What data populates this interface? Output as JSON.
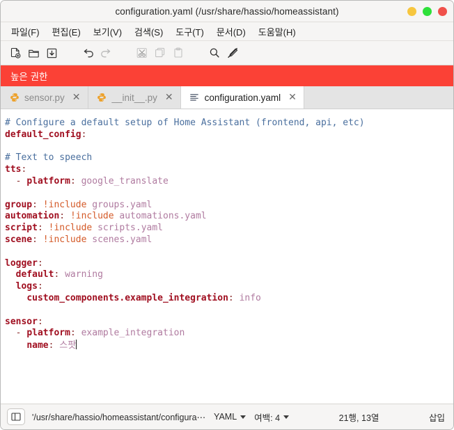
{
  "window": {
    "title": "configuration.yaml (/usr/share/hassio/homeassistant)",
    "controls": [
      {
        "name": "minimize",
        "color": "#f7c63e"
      },
      {
        "name": "maximize",
        "color": "#2ee03a"
      },
      {
        "name": "close",
        "color": "#f0504a"
      }
    ]
  },
  "menubar": {
    "items": [
      {
        "label": "파일(F)"
      },
      {
        "label": "편집(E)"
      },
      {
        "label": "보기(V)"
      },
      {
        "label": "검색(S)"
      },
      {
        "label": "도구(T)"
      },
      {
        "label": "문서(D)"
      },
      {
        "label": "도움말(H)"
      }
    ]
  },
  "toolbar": {
    "items": [
      {
        "icon": "new-file-icon",
        "enabled": true
      },
      {
        "icon": "open-folder-icon",
        "enabled": true
      },
      {
        "icon": "save-file-icon",
        "enabled": true
      },
      {
        "icon": "undo-icon",
        "enabled": true
      },
      {
        "icon": "redo-icon",
        "enabled": false
      },
      {
        "icon": "cut-icon",
        "enabled": false
      },
      {
        "icon": "copy-icon",
        "enabled": false
      },
      {
        "icon": "paste-icon",
        "enabled": false
      },
      {
        "icon": "search-icon",
        "enabled": true
      },
      {
        "icon": "highlight-off-icon",
        "enabled": true
      }
    ]
  },
  "banner": {
    "text": "높은 권한",
    "color": "#fb4136"
  },
  "tabs": [
    {
      "label": "sensor.py",
      "icon": "python-file-icon",
      "active": false,
      "close": "✕"
    },
    {
      "label": "__init__.py",
      "icon": "python-file-icon",
      "active": false,
      "close": "✕"
    },
    {
      "label": "configuration.yaml",
      "icon": "text-file-icon",
      "active": true,
      "close": "✕"
    }
  ],
  "editor": {
    "language": "YAML",
    "lines": [
      [
        {
          "t": "# Configure a default setup of Home Assistant (frontend, api, etc)",
          "c": "cm"
        }
      ],
      [
        {
          "t": "default_config",
          "c": "key"
        },
        {
          "t": ":",
          "c": "pun"
        }
      ],
      [
        {
          "t": "",
          "c": "cm"
        }
      ],
      [
        {
          "t": "# Text to speech",
          "c": "cm"
        }
      ],
      [
        {
          "t": "tts",
          "c": "key"
        },
        {
          "t": ":",
          "c": "pun"
        }
      ],
      [
        {
          "t": "  - ",
          "c": "pun"
        },
        {
          "t": "platform",
          "c": "key"
        },
        {
          "t": ": ",
          "c": "pun"
        },
        {
          "t": "google_translate",
          "c": "val"
        }
      ],
      [
        {
          "t": "",
          "c": "cm"
        }
      ],
      [
        {
          "t": "group",
          "c": "key"
        },
        {
          "t": ": ",
          "c": "pun"
        },
        {
          "t": "!include ",
          "c": "tag"
        },
        {
          "t": "groups.yaml",
          "c": "val"
        }
      ],
      [
        {
          "t": "automation",
          "c": "key"
        },
        {
          "t": ": ",
          "c": "pun"
        },
        {
          "t": "!include ",
          "c": "tag"
        },
        {
          "t": "automations.yaml",
          "c": "val"
        }
      ],
      [
        {
          "t": "script",
          "c": "key"
        },
        {
          "t": ": ",
          "c": "pun"
        },
        {
          "t": "!include ",
          "c": "tag"
        },
        {
          "t": "scripts.yaml",
          "c": "val"
        }
      ],
      [
        {
          "t": "scene",
          "c": "key"
        },
        {
          "t": ": ",
          "c": "pun"
        },
        {
          "t": "!include ",
          "c": "tag"
        },
        {
          "t": "scenes.yaml",
          "c": "val"
        }
      ],
      [
        {
          "t": "",
          "c": "cm"
        }
      ],
      [
        {
          "t": "logger",
          "c": "key"
        },
        {
          "t": ":",
          "c": "pun"
        }
      ],
      [
        {
          "t": "  ",
          "c": "pun"
        },
        {
          "t": "default",
          "c": "key"
        },
        {
          "t": ": ",
          "c": "pun"
        },
        {
          "t": "warning",
          "c": "val"
        }
      ],
      [
        {
          "t": "  ",
          "c": "pun"
        },
        {
          "t": "logs",
          "c": "key"
        },
        {
          "t": ":",
          "c": "pun"
        }
      ],
      [
        {
          "t": "    ",
          "c": "pun"
        },
        {
          "t": "custom_components.example_integration",
          "c": "key"
        },
        {
          "t": ": ",
          "c": "pun"
        },
        {
          "t": "info",
          "c": "val"
        }
      ],
      [
        {
          "t": "",
          "c": "cm"
        }
      ],
      [
        {
          "t": "sensor",
          "c": "key"
        },
        {
          "t": ":",
          "c": "pun"
        }
      ],
      [
        {
          "t": "  - ",
          "c": "pun"
        },
        {
          "t": "platform",
          "c": "key"
        },
        {
          "t": ": ",
          "c": "pun"
        },
        {
          "t": "example_integration",
          "c": "val"
        }
      ],
      [
        {
          "t": "    ",
          "c": "pun"
        },
        {
          "t": "name",
          "c": "key"
        },
        {
          "t": ": ",
          "c": "pun"
        },
        {
          "t": "스팟",
          "c": "val"
        },
        {
          "t": "|caret|",
          "c": "caret"
        }
      ]
    ]
  },
  "statusbar": {
    "sidebar_toggle_icon": "sidebar-toggle-icon",
    "path": "'/usr/share/hassio/homeassistant/configura⋯",
    "language": "YAML",
    "indent": "여백: 4",
    "position": "21행, 13열",
    "mode": "삽입"
  }
}
